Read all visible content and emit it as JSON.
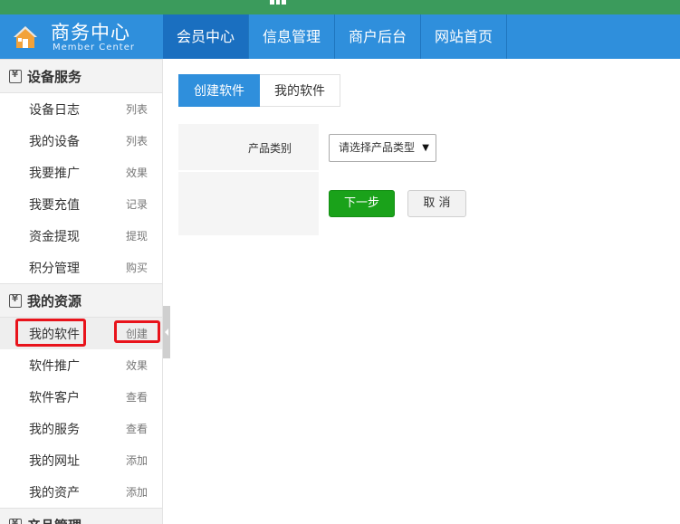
{
  "header": {
    "title": "商务中心",
    "subtitle": "Member Center",
    "nav": [
      {
        "label": "会员中心",
        "active": true
      },
      {
        "label": "信息管理",
        "active": false
      },
      {
        "label": "商户后台",
        "active": false
      },
      {
        "label": "网站首页",
        "active": false
      }
    ]
  },
  "sidebar": {
    "sections": [
      {
        "title": "设备服务",
        "items": [
          {
            "label": "设备日志",
            "action": "列表"
          },
          {
            "label": "我的设备",
            "action": "列表"
          },
          {
            "label": "我要推广",
            "action": "效果"
          },
          {
            "label": "我要充值",
            "action": "记录"
          },
          {
            "label": "资金提现",
            "action": "提现"
          },
          {
            "label": "积分管理",
            "action": "购买"
          }
        ]
      },
      {
        "title": "我的资源",
        "items": [
          {
            "label": "我的软件",
            "action": "创建"
          },
          {
            "label": "软件推广",
            "action": "效果"
          },
          {
            "label": "软件客户",
            "action": "查看"
          },
          {
            "label": "我的服务",
            "action": "查看"
          },
          {
            "label": "我的网址",
            "action": "添加"
          },
          {
            "label": "我的资产",
            "action": "添加"
          }
        ]
      },
      {
        "title": "产品管理",
        "items": []
      }
    ]
  },
  "main": {
    "tabs": [
      {
        "label": "创建软件",
        "active": true
      },
      {
        "label": "我的软件",
        "active": false
      }
    ],
    "form": {
      "category_label": "产品类别",
      "category_select": "请选择产品类型",
      "next_button": "下一步",
      "cancel_button": "取 消"
    }
  },
  "colors": {
    "brand_blue": "#2f8fdc",
    "top_green": "#3b9b5c",
    "next_green": "#1aa21a",
    "highlight_red": "#e8131b"
  }
}
